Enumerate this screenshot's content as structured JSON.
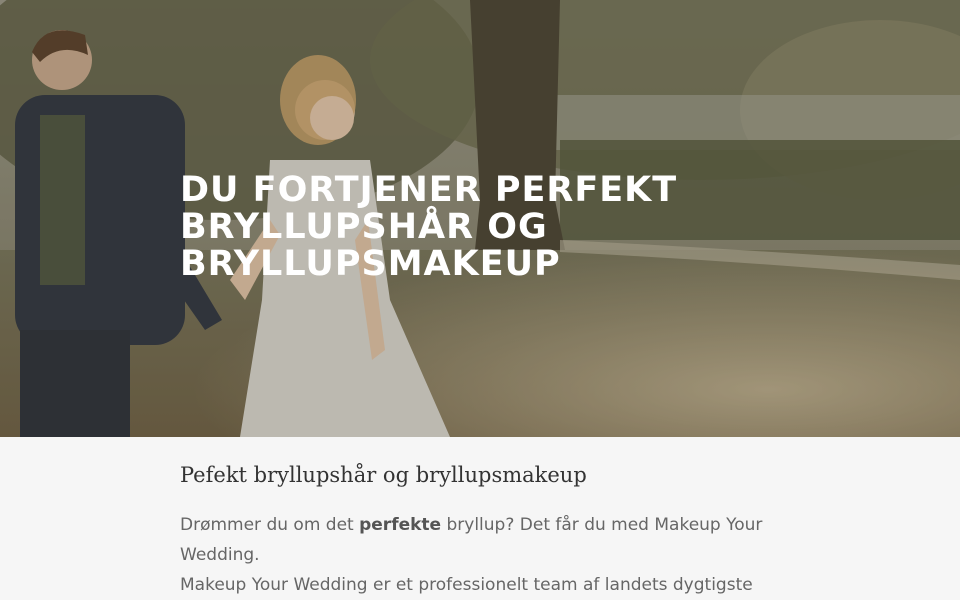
{
  "hero": {
    "title": "Du fortjener perfekt bryllupshår og bryllupsmakeup"
  },
  "content": {
    "heading": "Pefekt bryllupshår og bryllupsmakeup",
    "intro_before": "Drømmer du om det ",
    "intro_strong": "perfekte",
    "intro_after": " bryllup? Det får du med Makeup Your Wedding.",
    "second_line": "Makeup Your Wedding er et professionelt team af landets dygtigste"
  },
  "colors": {
    "hero_overlay": "#6d6452",
    "content_background": "#f6f6f6",
    "heading_text": "#333333",
    "body_text": "#666666"
  }
}
